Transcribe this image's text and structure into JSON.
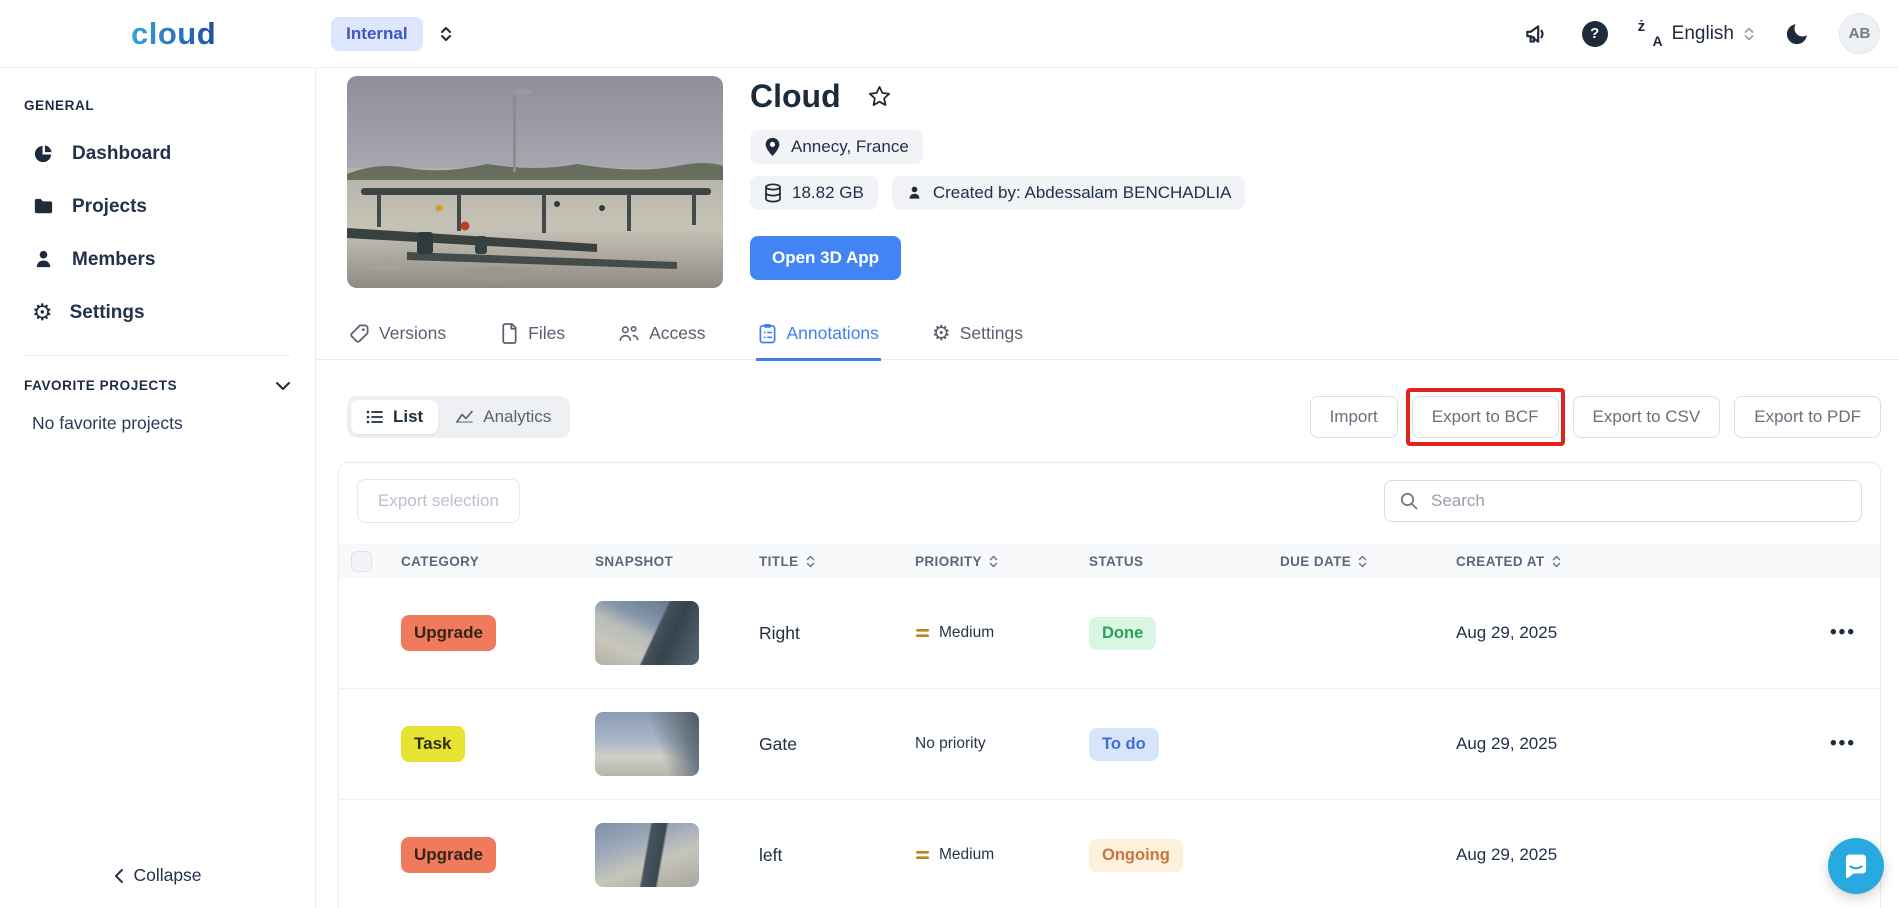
{
  "navbar": {
    "logo": "cloud",
    "workspace": "Internal",
    "language": "English",
    "avatar_initials": "AB"
  },
  "icons": {
    "help": "?",
    "gear": "⚙",
    "more": "•••",
    "translate_top": "ż",
    "translate_bottom": "A"
  },
  "sidebar": {
    "general_label": "GENERAL",
    "items": [
      {
        "label": "Dashboard",
        "icon": "pie-chart-icon"
      },
      {
        "label": "Projects",
        "icon": "folder-icon"
      },
      {
        "label": "Members",
        "icon": "person-icon"
      },
      {
        "label": "Settings",
        "icon": "gear-icon"
      }
    ],
    "favorites_label": "FAVORITE PROJECTS",
    "favorites_empty": "No favorite projects",
    "collapse_label": "Collapse"
  },
  "project": {
    "title": "Cloud",
    "location": "Annecy, France",
    "size": "18.82 GB",
    "created_by": "Created by: Abdessalam BENCHADLIA",
    "open_app_label": "Open 3D App"
  },
  "tabs": [
    {
      "label": "Versions",
      "icon": "tag-icon",
      "active": false
    },
    {
      "label": "Files",
      "icon": "file-icon",
      "active": false
    },
    {
      "label": "Access",
      "icon": "people-icon",
      "active": false
    },
    {
      "label": "Annotations",
      "icon": "clipboard-icon",
      "active": true
    },
    {
      "label": "Settings",
      "icon": "gear-icon",
      "active": false
    }
  ],
  "toolbar": {
    "view_toggle": [
      {
        "label": "List",
        "icon": "list-icon",
        "active": true
      },
      {
        "label": "Analytics",
        "icon": "area-chart-icon",
        "active": false
      }
    ],
    "import_label": "Import",
    "export_bcf_label": "Export to BCF",
    "export_bcf_highlighted": true,
    "export_csv_label": "Export to CSV",
    "export_pdf_label": "Export to PDF"
  },
  "table": {
    "export_selection_label": "Export selection",
    "search_placeholder": "Search",
    "columns": [
      {
        "label": "CATEGORY",
        "sortable": false
      },
      {
        "label": "SNAPSHOT",
        "sortable": false
      },
      {
        "label": "TITLE",
        "sortable": true
      },
      {
        "label": "PRIORITY",
        "sortable": true
      },
      {
        "label": "STATUS",
        "sortable": false
      },
      {
        "label": "DUE DATE",
        "sortable": true
      },
      {
        "label": "CREATED AT",
        "sortable": true
      }
    ],
    "rows": [
      {
        "category": "Upgrade",
        "category_color": "#F1795C",
        "title": "Right",
        "priority": "Medium",
        "priority_level": "medium",
        "status": "Done",
        "status_bg": "#D9F6E5",
        "status_color": "#2E9E5B",
        "due_date": "",
        "created_at": "Aug 29, 2025"
      },
      {
        "category": "Task",
        "category_color": "#E7E431",
        "title": "Gate",
        "priority": "No priority",
        "priority_level": "none",
        "status": "To do",
        "status_bg": "#D7E5FB",
        "status_color": "#3D6ED9",
        "due_date": "",
        "created_at": "Aug 29, 2025"
      },
      {
        "category": "Upgrade",
        "category_color": "#F1795C",
        "title": "left",
        "priority": "Medium",
        "priority_level": "medium",
        "status": "Ongoing",
        "status_bg": "#FDF0DC",
        "status_color": "#C8763F",
        "due_date": "",
        "created_at": "Aug 29, 2025"
      }
    ]
  },
  "colors": {
    "accent_blue": "#4384F5",
    "active_tab_blue": "#4080EE",
    "highlight_red": "#E0231C",
    "workspace_badge_bg": "#DDE6FC",
    "workspace_badge_text": "#3F55C5",
    "priority_medium_icon": "#B8861B",
    "chat_bubble_blue": "#2AA9E0",
    "navy_text": "#1E2B3D"
  }
}
